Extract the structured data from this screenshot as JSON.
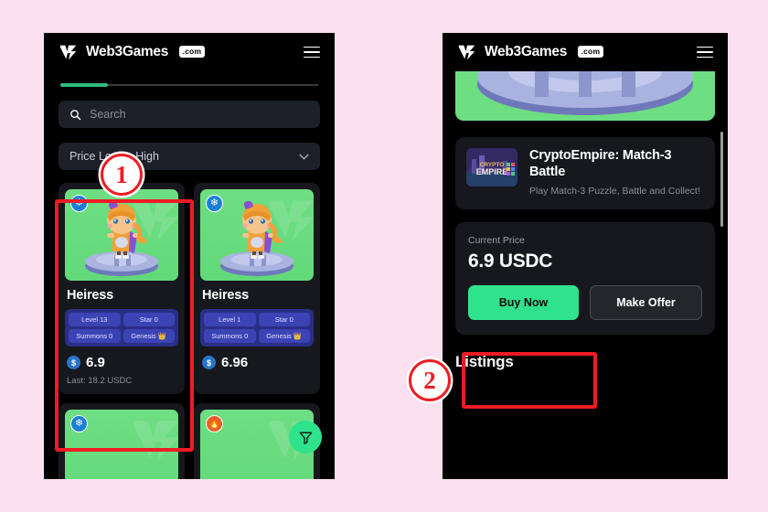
{
  "background_color": "#fbe0f0",
  "accent_green": "#2fe38c",
  "annotation_color": "#ed1c24",
  "brand": {
    "name": "Web3Games",
    "badge": ".com",
    "logo_icon": "web3games-logo-icon"
  },
  "left_phone": {
    "header": {
      "menu_icon": "hamburger-menu-icon"
    },
    "search": {
      "placeholder": "Search",
      "icon": "search-icon"
    },
    "sort": {
      "value": "Price Low to High",
      "chevron_icon": "chevron-down-icon"
    },
    "filter_fab": {
      "icon": "filter-funnel-icon"
    },
    "cards": [
      {
        "name": "Heiress",
        "element_badge_icon": "snowflake-icon",
        "stats": [
          "Level 13",
          "Star 0",
          "Summons 0",
          "Genesis 👑"
        ],
        "currency_icon": "usdc-coin-icon",
        "price": "6.9",
        "last_sale": "Last: 18.2 USDC"
      },
      {
        "name": "Heiress",
        "element_badge_icon": "snowflake-icon",
        "stats": [
          "Level 1",
          "Star 0",
          "Summons 0",
          "Genesis 👑"
        ],
        "currency_icon": "usdc-coin-icon",
        "price": "6.96",
        "last_sale": ""
      }
    ]
  },
  "right_phone": {
    "header": {
      "menu_icon": "hamburger-menu-icon"
    },
    "game": {
      "title": "CryptoEmpire: Match-3 Battle",
      "subtitle": "Play Match-3 Puzzle, Battle and Collect!",
      "thumb_icon": "cryptoempire-thumbnail"
    },
    "price_panel": {
      "label": "Current Price",
      "amount": "6.9 USDC",
      "buy_label": "Buy Now",
      "offer_label": "Make Offer"
    },
    "listings_heading": "Listings"
  },
  "annotations": [
    {
      "number": "1",
      "target": "sort-dropdown"
    },
    {
      "number": "2",
      "target": "buy-now-button"
    }
  ]
}
